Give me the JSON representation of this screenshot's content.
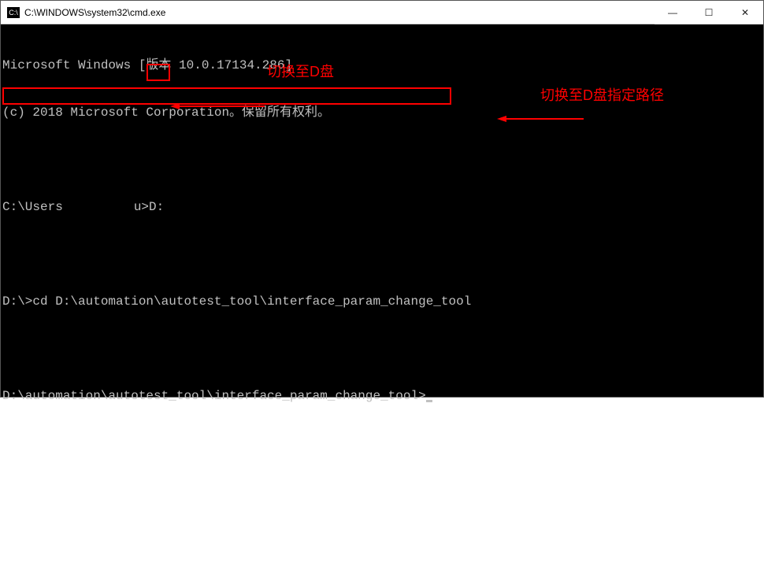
{
  "window": {
    "icon_text": "C:\\",
    "title": "C:\\WINDOWS\\system32\\cmd.exe"
  },
  "buttons": {
    "minimize": "—",
    "maximize": "☐",
    "close": "✕"
  },
  "terminal": {
    "line1": "Microsoft Windows [版本 10.0.17134.286]",
    "line2": "(c) 2018 Microsoft Corporation。保留所有权利。",
    "line3_prefix": "C:\\Users",
    "line3_mid": "u>",
    "line3_cmd": "D:",
    "line4": "D:\\>cd D:\\automation\\autotest_tool\\interface_param_change_tool",
    "line5": "D:\\automation\\autotest_tool\\interface_param_change_tool>"
  },
  "annotations": {
    "label1": "切换至D盘",
    "label2": "切换至D盘指定路径"
  }
}
